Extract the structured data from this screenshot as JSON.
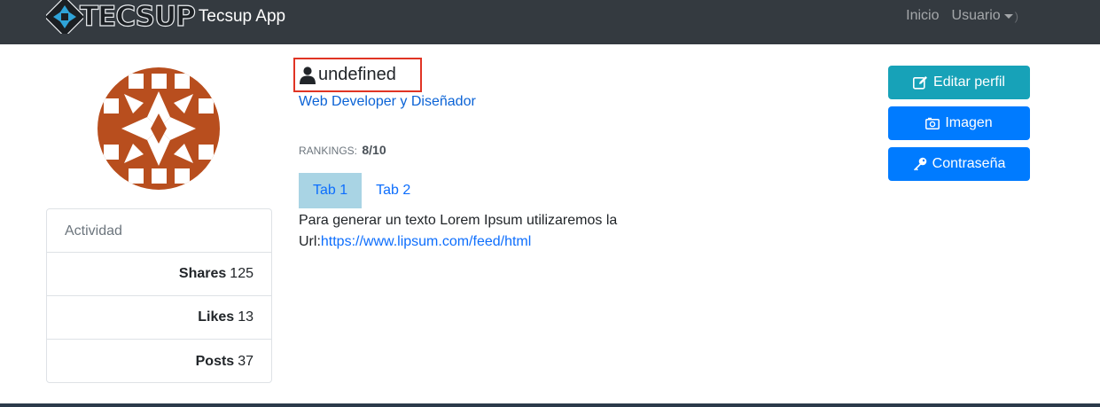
{
  "navbar": {
    "logo_text": "TECSUP",
    "brand": "Tecsup App",
    "links": [
      "Inicio",
      "Usuario"
    ],
    "trailing": ")"
  },
  "profile": {
    "username": "undefined",
    "role": "Web Developer y Diseñador",
    "rankings_label": "RANKINGS:",
    "rankings_value": "8/10"
  },
  "tabs": [
    "Tab 1",
    "Tab 2"
  ],
  "tab_content": {
    "text": "Para generar un texto Lorem Ipsum utilizaremos la Url:",
    "link": "https://www.lipsum.com/feed/html"
  },
  "activity": {
    "header": "Actividad",
    "rows": [
      {
        "label": "Shares",
        "value": "125"
      },
      {
        "label": "Likes",
        "value": "13"
      },
      {
        "label": "Posts",
        "value": "37"
      }
    ]
  },
  "actions": {
    "edit": "Editar perfil",
    "image": "Imagen",
    "password": "Contraseña"
  },
  "colors": {
    "navbar": "#343a40",
    "info": "#17a2b8",
    "primary": "#007bff",
    "highlight": "#e03424",
    "avatar": "#b84e1e"
  }
}
